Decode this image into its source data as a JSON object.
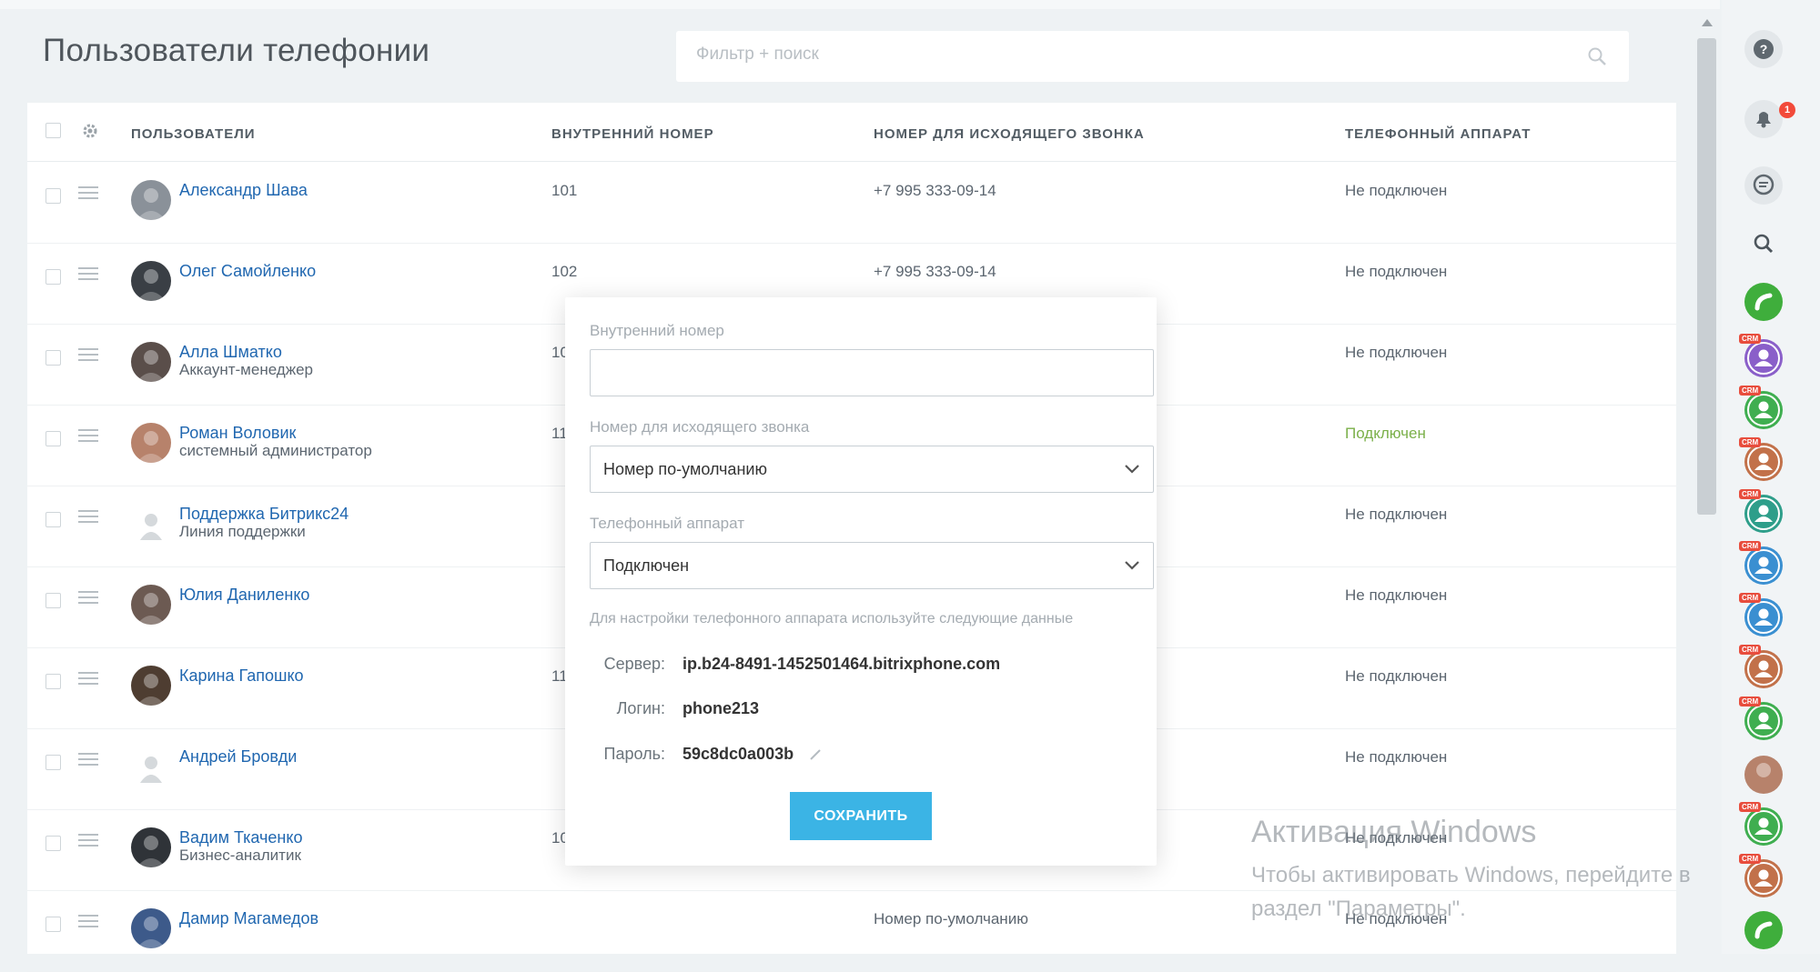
{
  "page": {
    "title": "Пользователи телефонии",
    "search_placeholder": "Фильтр + поиск"
  },
  "table": {
    "headers": {
      "users": "ПОЛЬЗОВАТЕЛИ",
      "internal": "ВНУТРЕННИЙ НОМЕР",
      "outgoing": "НОМЕР ДЛЯ ИСХОДЯЩЕГО ЗВОНКА",
      "device": "ТЕЛЕФОННЫЙ АППАРАТ"
    },
    "rows": [
      {
        "name": "Александр Шава",
        "position": "",
        "internal": "101",
        "outgoing": "+7 995 333-09-14",
        "device": "Не подключен",
        "device_connected": false
      },
      {
        "name": "Олег Самойленко",
        "position": "",
        "internal": "102",
        "outgoing": "+7 995 333-09-14",
        "device": "Не подключен",
        "device_connected": false
      },
      {
        "name": "Алла Шматко",
        "position": "Аккаунт-менеджер",
        "internal": "10",
        "outgoing": "",
        "device": "Не подключен",
        "device_connected": false
      },
      {
        "name": "Роман Воловик",
        "position": "системный администратор",
        "internal": "11",
        "outgoing": "",
        "device": "Подключен",
        "device_connected": true
      },
      {
        "name": "Поддержка Битрикс24",
        "position": "Линия поддержки",
        "internal": "",
        "outgoing": "",
        "device": "Не подключен",
        "device_connected": false
      },
      {
        "name": "Юлия Даниленко",
        "position": "",
        "internal": "",
        "outgoing": "",
        "device": "Не подключен",
        "device_connected": false
      },
      {
        "name": "Карина Гапошко",
        "position": "",
        "internal": "11",
        "outgoing": "",
        "device": "Не подключен",
        "device_connected": false
      },
      {
        "name": "Андрей Бровди",
        "position": "",
        "internal": "",
        "outgoing": "",
        "device": "Не подключен",
        "device_connected": false
      },
      {
        "name": "Вадим Ткаченко",
        "position": "Бизнес-аналитик",
        "internal": "10",
        "outgoing": "",
        "device": "Не подключен",
        "device_connected": false
      },
      {
        "name": "Дамир Магамедов",
        "position": "",
        "internal": "",
        "outgoing": "Номер по-умолчанию",
        "device": "Не подключен",
        "device_connected": false
      }
    ]
  },
  "popup": {
    "internal_label": "Внутренний номер",
    "internal_value": "",
    "outgoing_label": "Номер для исходящего звонка",
    "outgoing_value": "Номер по-умолчанию",
    "device_label": "Телефонный аппарат",
    "device_value": "Подключен",
    "hint": "Для настройки телефонного аппарата используйте следующие данные",
    "server_key": "Сервер:",
    "server_value": "ip.b24-8491-1452501464.bitrixphone.com",
    "login_key": "Логин:",
    "login_value": "phone213",
    "password_key": "Пароль:",
    "password_value": "59c8dc0a003b",
    "save_label": "СОХРАНИТЬ"
  },
  "right_panel": {
    "notification_count": "1",
    "crm_tag": "CRM",
    "icons": [
      "help-icon",
      "bell-icon",
      "chat-icon",
      "search-icon",
      "phone-icon",
      "crm-contact",
      "crm-contact",
      "crm-contact",
      "crm-contact",
      "crm-contact",
      "crm-contact",
      "crm-contact",
      "crm-contact",
      "user-avatar",
      "crm-contact",
      "crm-contact",
      "phone-icon"
    ]
  },
  "watermark": {
    "title": "Активация Windows",
    "text": "Чтобы активировать Windows, перейдите в раздел \"Параметры\"."
  },
  "colors": {
    "link": "#2067b0",
    "connected": "#7bb04a",
    "save_button": "#3bb4e5",
    "badge": "#f24a3a"
  }
}
